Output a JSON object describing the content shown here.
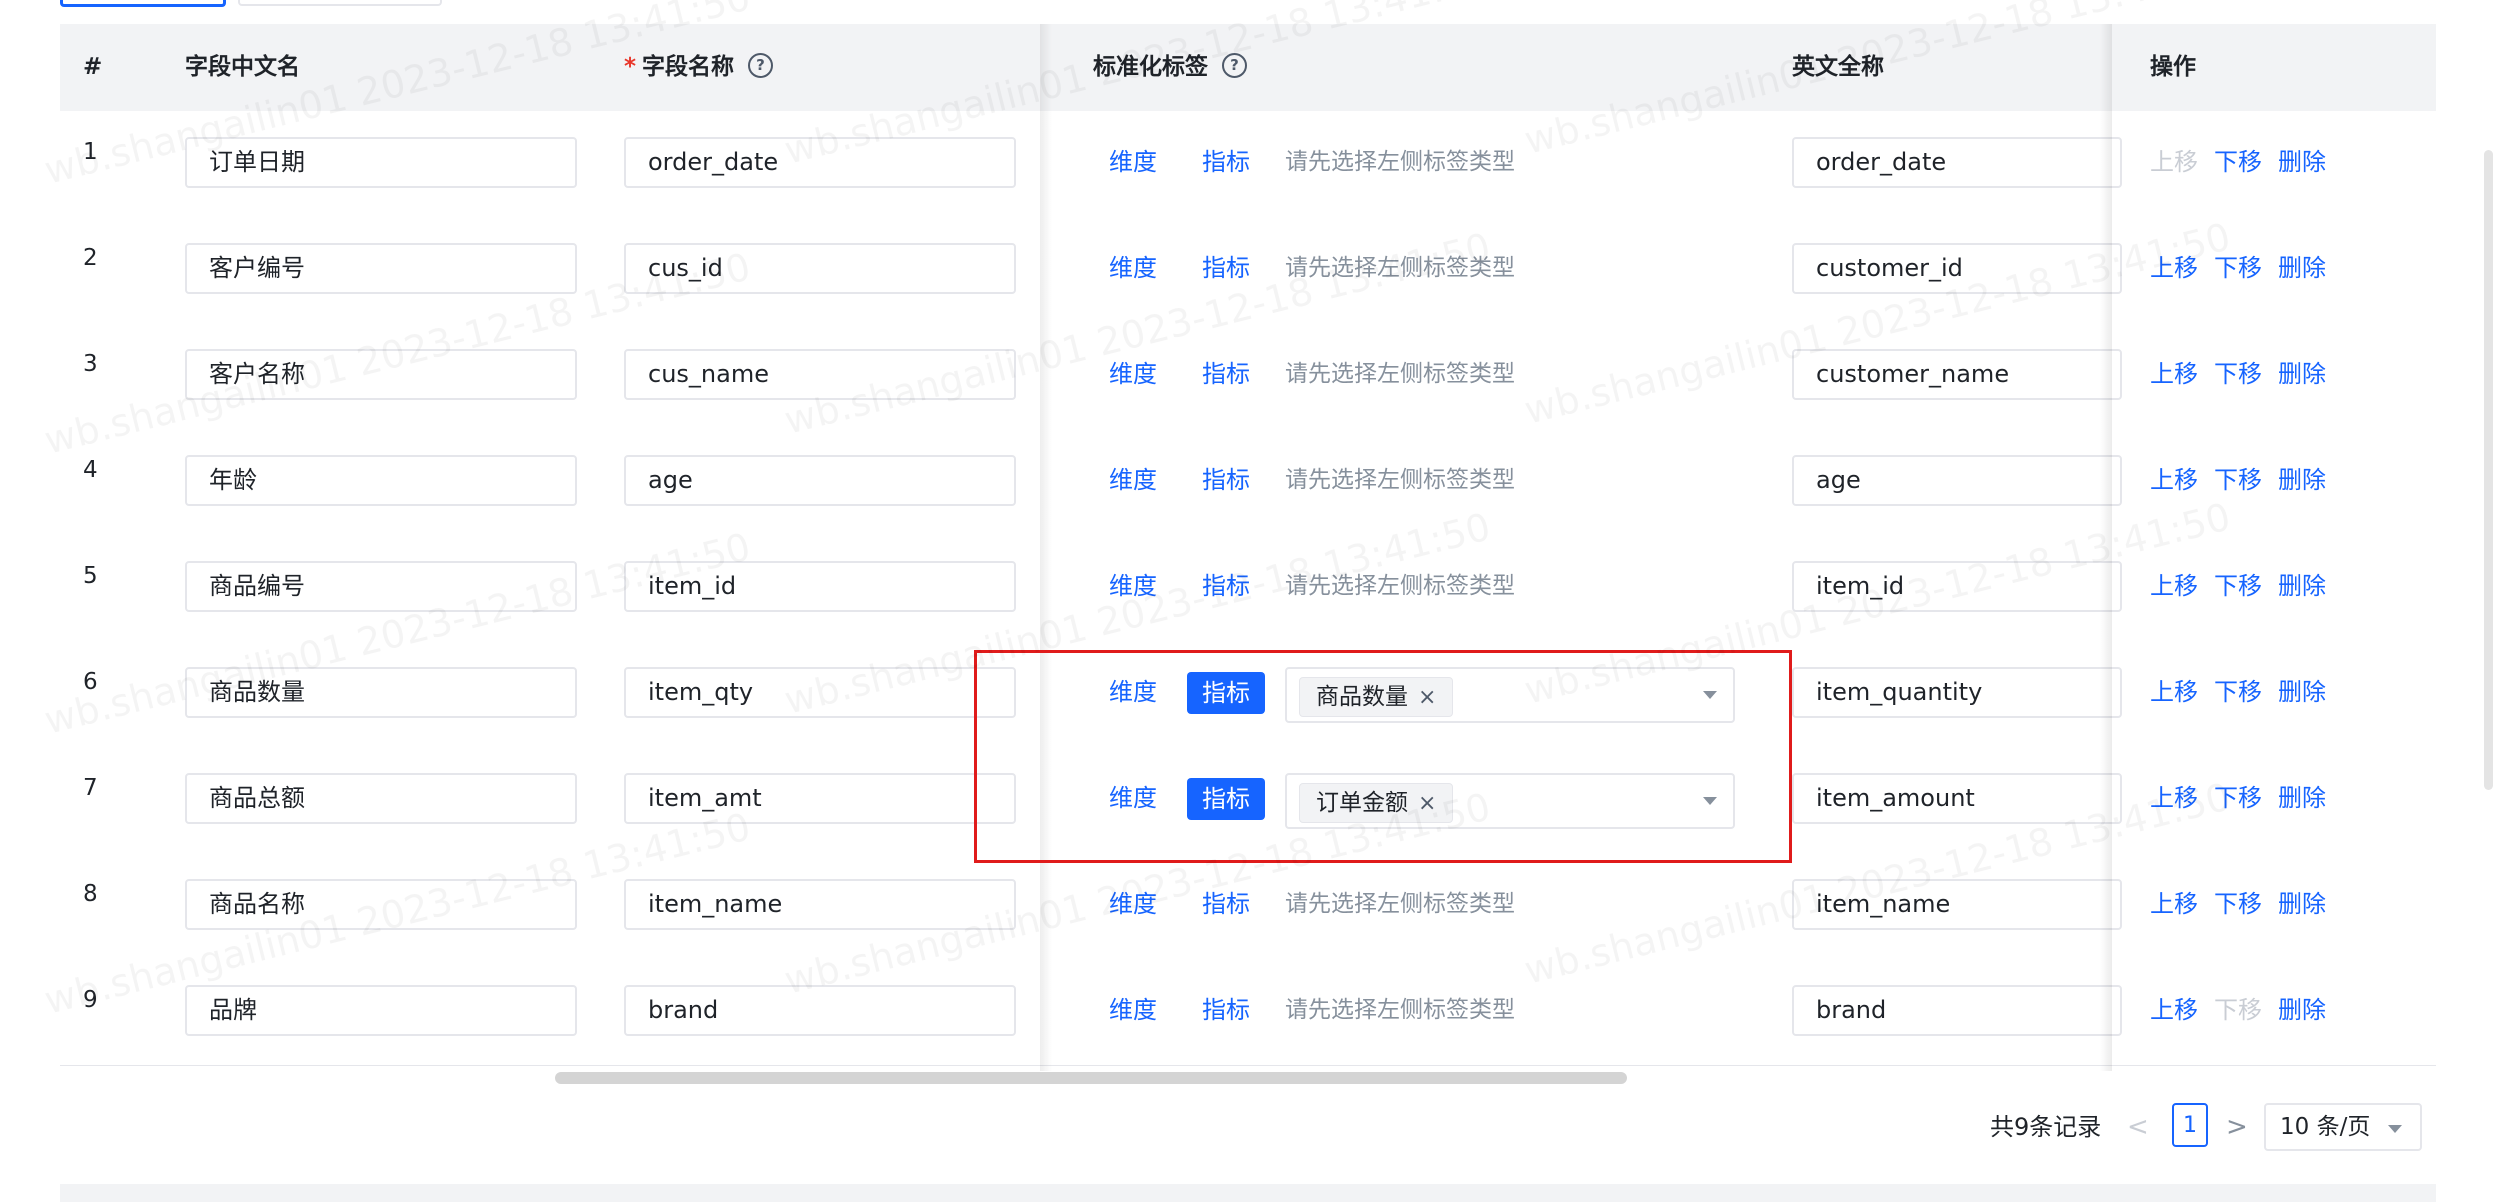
{
  "columns": {
    "index": "#",
    "cn_name": "字段中文名",
    "required_mark": "*",
    "field_name": "字段名称",
    "std_tag": "标准化标签",
    "en_full": "英文全称",
    "ops": "操作",
    "help_glyph": "?"
  },
  "labels": {
    "dimension": "维度",
    "metric": "指标",
    "placeholder_hint": "请先选择左侧标签类型",
    "move_up": "上移",
    "move_down": "下移",
    "delete": "删除",
    "chip_close": "×"
  },
  "rows": [
    {
      "index": "1",
      "cn_name": "订单日期",
      "field_name": "order_date",
      "en_name": "order_date",
      "metric_active": false,
      "tag": "",
      "up_disabled": true,
      "down_disabled": false
    },
    {
      "index": "2",
      "cn_name": "客户编号",
      "field_name": "cus_id",
      "en_name": "customer_id",
      "metric_active": false,
      "tag": "",
      "up_disabled": false,
      "down_disabled": false
    },
    {
      "index": "3",
      "cn_name": "客户名称",
      "field_name": "cus_name",
      "en_name": "customer_name",
      "metric_active": false,
      "tag": "",
      "up_disabled": false,
      "down_disabled": false
    },
    {
      "index": "4",
      "cn_name": "年龄",
      "field_name": "age",
      "en_name": "age",
      "metric_active": false,
      "tag": "",
      "up_disabled": false,
      "down_disabled": false
    },
    {
      "index": "5",
      "cn_name": "商品编号",
      "field_name": "item_id",
      "en_name": "item_id",
      "metric_active": false,
      "tag": "",
      "up_disabled": false,
      "down_disabled": false
    },
    {
      "index": "6",
      "cn_name": "商品数量",
      "field_name": "item_qty",
      "en_name": "item_quantity",
      "metric_active": true,
      "tag": "商品数量",
      "up_disabled": false,
      "down_disabled": false
    },
    {
      "index": "7",
      "cn_name": "商品总额",
      "field_name": "item_amt",
      "en_name": "item_amount",
      "metric_active": true,
      "tag": "订单金额",
      "up_disabled": false,
      "down_disabled": false
    },
    {
      "index": "8",
      "cn_name": "商品名称",
      "field_name": "item_name",
      "en_name": "item_name",
      "metric_active": false,
      "tag": "",
      "up_disabled": false,
      "down_disabled": false
    },
    {
      "index": "9",
      "cn_name": "品牌",
      "field_name": "brand",
      "en_name": "brand",
      "metric_active": false,
      "tag": "",
      "up_disabled": false,
      "down_disabled": true
    }
  ],
  "pagination": {
    "total": "共9条记录",
    "prev": "<",
    "current": "1",
    "next": ">",
    "page_size": "10 条/页"
  },
  "watermark": "wb.shangailin01 2023-12-18 13:41:50",
  "colors": {
    "primary": "#1664ff",
    "disabled": "#c9cdd4",
    "highlight": "#e01b1b",
    "header_bg": "#f2f3f5"
  }
}
